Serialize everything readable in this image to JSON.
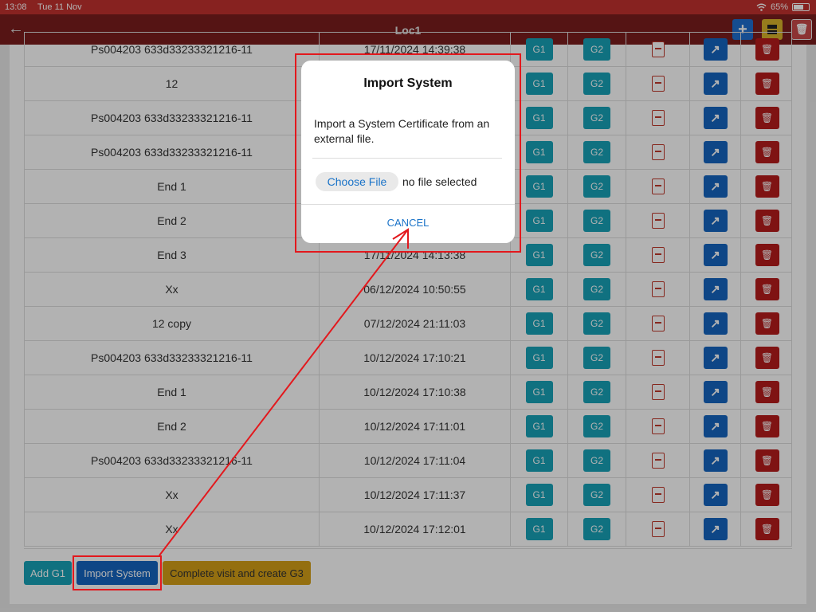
{
  "status_bar": {
    "time": "13:08",
    "date": "Tue 11 Nov",
    "battery": "65%"
  },
  "nav": {
    "back_icon": "←",
    "title": "Loc1",
    "add_icon": "+",
    "delete_icon": "🗑"
  },
  "table": {
    "g1_label": "G1",
    "g2_label": "G2",
    "delete_icon": "🗑",
    "share_icon": "↗",
    "rows": [
      {
        "name": "Ps004203 633d33233321216-11",
        "date": "17/11/2024 14:39:38"
      },
      {
        "name": "12",
        "date": ""
      },
      {
        "name": "Ps004203 633d33233321216-11",
        "date": ""
      },
      {
        "name": "Ps004203 633d33233321216-11",
        "date": ""
      },
      {
        "name": "End 1",
        "date": ""
      },
      {
        "name": "End 2",
        "date": ""
      },
      {
        "name": "End 3",
        "date": "17/11/2024 14:13:38"
      },
      {
        "name": "Xx",
        "date": "06/12/2024 10:50:55"
      },
      {
        "name": "12 copy",
        "date": "07/12/2024 21:11:03"
      },
      {
        "name": "Ps004203 633d33233321216-11",
        "date": "10/12/2024 17:10:21"
      },
      {
        "name": "End 1",
        "date": "10/12/2024 17:10:38"
      },
      {
        "name": "End 2",
        "date": "10/12/2024 17:11:01"
      },
      {
        "name": "Ps004203 633d33233321216-11",
        "date": "10/12/2024 17:11:04"
      },
      {
        "name": "Xx",
        "date": "10/12/2024 17:11:37"
      },
      {
        "name": "Xx",
        "date": "10/12/2024 17:12:01"
      }
    ]
  },
  "footer": {
    "add_g1": "Add G1",
    "import_system": "Import System",
    "complete_visit": "Complete visit and create G3"
  },
  "modal": {
    "title": "Import System",
    "body": "Import a System Certificate from an external file.",
    "choose_file": "Choose File",
    "no_file": "no file selected",
    "cancel": "CANCEL"
  },
  "colors": {
    "status_bar": "#c2312f",
    "nav_bar": "#7a1d1d",
    "g_button": "#17a2b8",
    "share_button": "#1565c0",
    "delete_button": "#b71c1c",
    "complete_button": "#d4a017",
    "annotation": "#e3181d"
  }
}
